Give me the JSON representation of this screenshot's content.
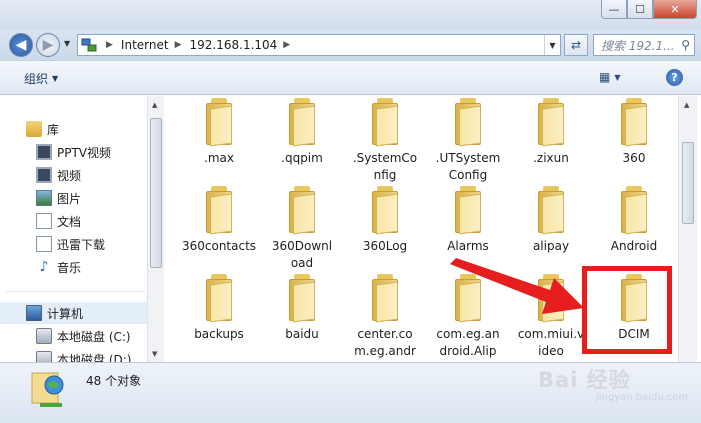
{
  "window": {
    "controls": {
      "minimize": "—",
      "maximize": "☐",
      "close": "✕"
    }
  },
  "address": {
    "crumbs": [
      "Internet",
      "192.168.1.104"
    ],
    "search_placeholder": "搜索 192.1..."
  },
  "toolbar": {
    "organize_label": "组织",
    "help_label": "?"
  },
  "sidebar": {
    "items": [
      {
        "label": "库",
        "icon": "library-icon"
      },
      {
        "label": "PPTV视频",
        "icon": "video-icon"
      },
      {
        "label": "视频",
        "icon": "video-icon"
      },
      {
        "label": "图片",
        "icon": "picture-icon"
      },
      {
        "label": "文档",
        "icon": "document-icon"
      },
      {
        "label": "迅雷下载",
        "icon": "download-icon"
      },
      {
        "label": "音乐",
        "icon": "music-icon"
      },
      {
        "label": "计算机",
        "icon": "computer-icon"
      },
      {
        "label": "本地磁盘 (C:)",
        "icon": "disk-icon"
      },
      {
        "label": "本地磁盘 (D:)",
        "icon": "disk-icon"
      }
    ]
  },
  "folders": [
    ".max",
    ".qqpim",
    ".SystemConfig",
    ".UTSystemConfig",
    ".zixun",
    "360",
    "360contacts",
    "360Download",
    "360Log",
    "Alarms",
    "alipay",
    "Android",
    "backups",
    "baidu",
    "center.com.eg.android.Alipay...",
    "com.eg.android.AlipayGphone...",
    "com.miui.video",
    "DCIM"
  ],
  "folder_display": [
    [
      ".max"
    ],
    [
      ".qqpim"
    ],
    [
      ".SystemCo",
      "nfig"
    ],
    [
      ".UTSystem",
      "Config"
    ],
    [
      ".zixun"
    ],
    [
      "360"
    ],
    [
      "360contacts"
    ],
    [
      "360Downl",
      "oad"
    ],
    [
      "360Log"
    ],
    [
      "Alarms"
    ],
    [
      "alipay"
    ],
    [
      "Android"
    ],
    [
      "backups"
    ],
    [
      "baidu"
    ],
    [
      "center.co",
      "m.eg.andr",
      "oid.Alipay..."
    ],
    [
      "com.eg.an",
      "droid.Alip",
      "ayGphone..."
    ],
    [
      "com.miui.v",
      "ideo"
    ],
    [
      "DCIM"
    ]
  ],
  "status": {
    "count_text": "48 个对象"
  },
  "watermark": {
    "brand": "Bai 经验",
    "url": "jingyan.baidu.com"
  },
  "colors": {
    "highlight": "#e61e1e",
    "folder": "#f0d78a"
  }
}
